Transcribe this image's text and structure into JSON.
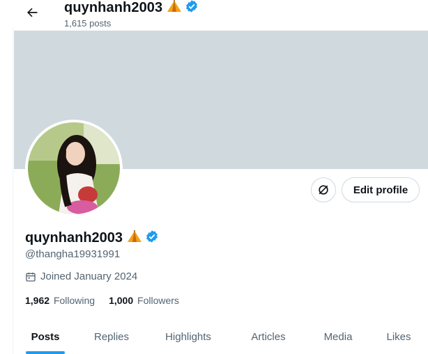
{
  "header": {
    "name": "quynhanh2003",
    "posts_count": "1,615 posts"
  },
  "profile": {
    "display_name": "quynhanh2003",
    "handle": "@thangha19931991",
    "joined": "Joined January 2024",
    "following_count": "1,962",
    "following_label": "Following",
    "followers_count": "1,000",
    "followers_label": "Followers",
    "edit_button": "Edit profile"
  },
  "tabs": [
    {
      "label": "Posts",
      "active": true
    },
    {
      "label": "Replies"
    },
    {
      "label": "Highlights"
    },
    {
      "label": "Articles"
    },
    {
      "label": "Media"
    },
    {
      "label": "Likes"
    }
  ],
  "icons": {
    "back": "arrow-left-icon",
    "tent": "tent-emoji-icon",
    "verified": "verified-badge-icon",
    "calendar": "calendar-icon",
    "premium": "no-link-circle-icon"
  },
  "colors": {
    "accent": "#1d9bf0",
    "banner": "#cfd9de",
    "muted_text": "#536471"
  }
}
